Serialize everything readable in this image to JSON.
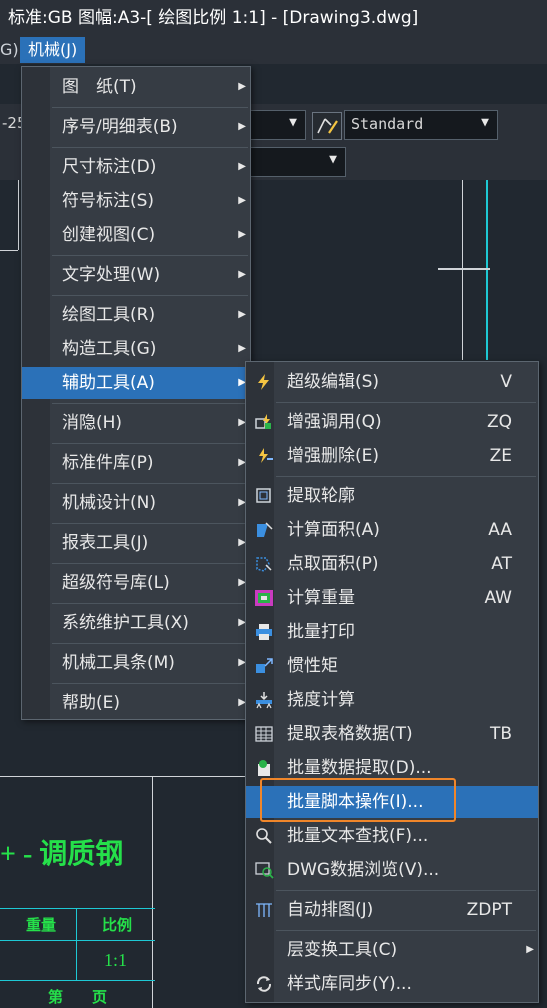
{
  "title": "标准:GB 图幅:A3-[ 绘图比例 1:1] - [Drawing3.dwg]",
  "menubar": {
    "prev_fragment": "G)",
    "active_menu": "机械(J)"
  },
  "toolbar": {
    "left_fragment": "-25",
    "style_combo_value": "Standard",
    "arrow": "▼"
  },
  "canvas": {
    "title_text": "+ - 调质钢",
    "table_labels": [
      "重量",
      "比例",
      "1:1",
      "第",
      "页"
    ]
  },
  "main_menu": {
    "items": [
      {
        "label": "图　纸(T)",
        "sub": "▶"
      },
      {
        "label": "序号/明细表(B)",
        "sub": "▶"
      },
      {
        "label": "尺寸标注(D)",
        "sub": "▶"
      },
      {
        "label": "符号标注(S)",
        "sub": "▶"
      },
      {
        "label": "创建视图(C)",
        "sub": "▶"
      },
      {
        "label": "文字处理(W)",
        "sub": "▶"
      },
      {
        "label": "绘图工具(R)",
        "sub": "▶"
      },
      {
        "label": "构造工具(G)",
        "sub": "▶"
      },
      {
        "label": "辅助工具(A)",
        "sub": "▶"
      },
      {
        "label": "消隐(H)",
        "sub": "▶"
      },
      {
        "label": "标准件库(P)",
        "sub": "▶"
      },
      {
        "label": "机械设计(N)",
        "sub": "▶"
      },
      {
        "label": "报表工具(J)",
        "sub": "▶"
      },
      {
        "label": "超级符号库(L)",
        "sub": "▶"
      },
      {
        "label": "系统维护工具(X)",
        "sub": "▶"
      },
      {
        "label": "机械工具条(M)",
        "sub": "▶"
      },
      {
        "label": "帮助(E)",
        "sub": "▶"
      }
    ]
  },
  "sub_menu": {
    "items": [
      {
        "label": "超级编辑(S)",
        "shortcut": "V",
        "icon": "lightning-icon"
      },
      {
        "label": "增强调用(Q)",
        "shortcut": "ZQ",
        "icon": "enhanced-call-icon"
      },
      {
        "label": "增强删除(E)",
        "shortcut": "ZE",
        "icon": "enhanced-delete-icon"
      },
      {
        "label": "提取轮廓",
        "shortcut": "",
        "icon": "outline-icon"
      },
      {
        "label": "计算面积(A)",
        "shortcut": "AA",
        "icon": "area-icon"
      },
      {
        "label": "点取面积(P)",
        "shortcut": "AT",
        "icon": "pick-area-icon"
      },
      {
        "label": "计算重量",
        "shortcut": "AW",
        "icon": "weight-icon"
      },
      {
        "label": "批量打印",
        "shortcut": "",
        "icon": "printer-icon"
      },
      {
        "label": "惯性矩",
        "shortcut": "",
        "icon": "inertia-icon"
      },
      {
        "label": "挠度计算",
        "shortcut": "",
        "icon": "deflection-icon"
      },
      {
        "label": "提取表格数据(T)",
        "shortcut": "TB",
        "icon": "table-icon"
      },
      {
        "label": "批量数据提取(D)...",
        "shortcut": "",
        "icon": "data-extract-icon"
      },
      {
        "label": "批量脚本操作(I)...",
        "shortcut": "",
        "icon": ""
      },
      {
        "label": "批量文本查找(F)...",
        "shortcut": "",
        "icon": "text-search-icon"
      },
      {
        "label": "DWG数据浏览(V)...",
        "shortcut": "",
        "icon": "dwg-browse-icon"
      },
      {
        "label": "自动排图(J)",
        "shortcut": "ZDPT",
        "icon": "auto-layout-icon"
      },
      {
        "label": "层变换工具(C)",
        "shortcut": "",
        "sub": "▶",
        "icon": ""
      },
      {
        "label": "样式库同步(Y)...",
        "shortcut": "",
        "icon": "sync-icon"
      }
    ]
  },
  "colors": {
    "highlight": "#2b71b8",
    "focus_box": "#f0862a",
    "drawing_green": "#25e04a",
    "drawing_cyan": "#1ec9d4"
  }
}
